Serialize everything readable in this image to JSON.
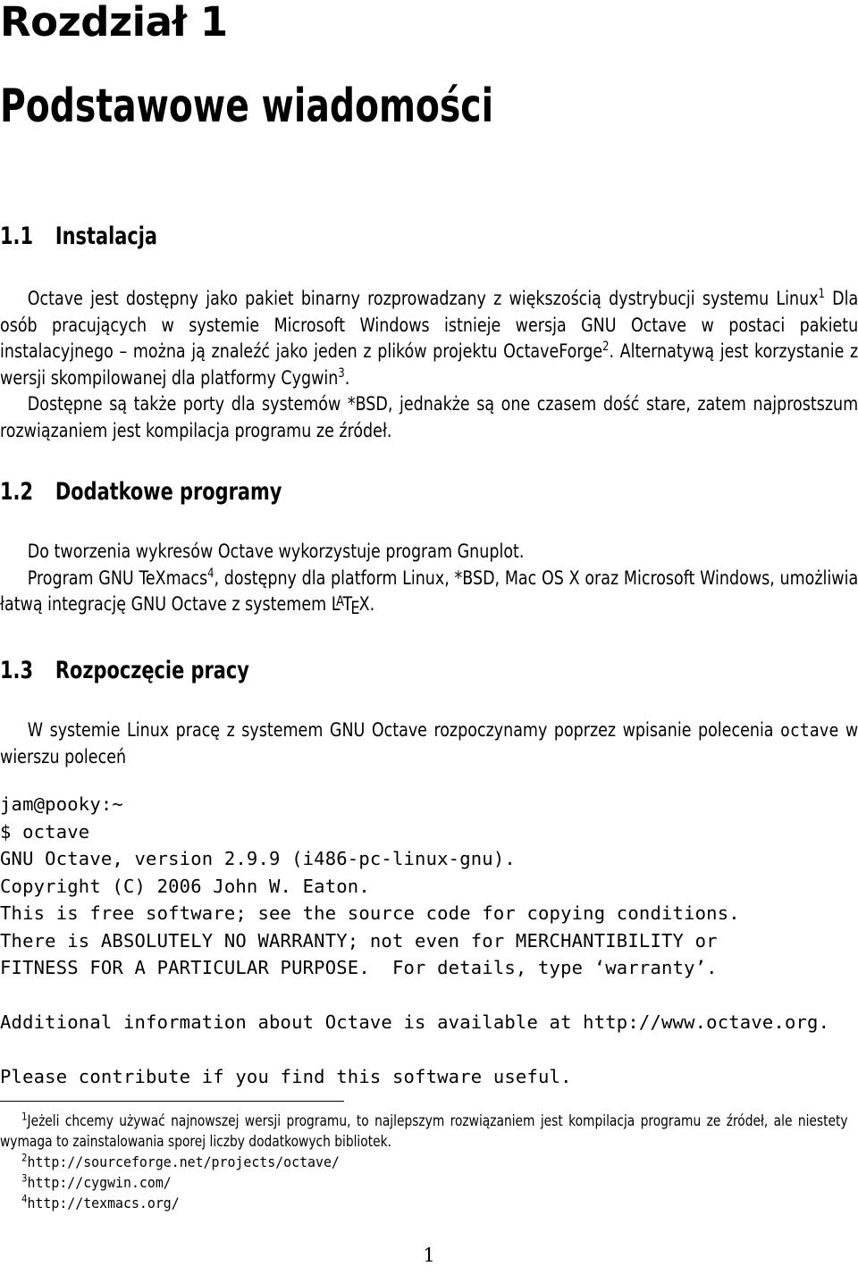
{
  "document": {
    "chapter_label": "Rozdział 1",
    "chapter_title": "Podstawowe wiadomości",
    "page_number": "1"
  },
  "sections": [
    {
      "number": "1.1",
      "title": "Instalacja",
      "paragraphs": [
        {
          "indent": true,
          "runs": [
            {
              "type": "text",
              "text": "Octave jest dostępny jako pakiet binarny rozprowadzany z większością dystrybucji systemu Linux"
            },
            {
              "type": "footnote_mark",
              "text": "1"
            },
            {
              "type": "text",
              "text": " Dla osób pracujących w systemie Microsoft Windows istnieje wersja GNU Octave w postaci pakietu instalacyjnego – można ją znaleźć jako jeden z plików projektu OctaveForge"
            },
            {
              "type": "footnote_mark",
              "text": "2"
            },
            {
              "type": "text",
              "text": ". Alternatywą jest korzystanie z wersji skompilowanej dla platformy Cygwin"
            },
            {
              "type": "footnote_mark",
              "text": "3"
            },
            {
              "type": "text",
              "text": "."
            }
          ]
        },
        {
          "indent": true,
          "runs": [
            {
              "type": "text",
              "text": "Dostępne są także porty dla systemów *BSD, jednakże są one czasem dość stare, zatem najprostszum rozwiązaniem jest kompilacja programu ze źródeł."
            }
          ]
        }
      ]
    },
    {
      "number": "1.2",
      "title": "Dodatkowe programy",
      "paragraphs": [
        {
          "indent": true,
          "runs": [
            {
              "type": "text",
              "text": "Do tworzenia wykresów Octave wykorzystuje program Gnuplot."
            }
          ]
        },
        {
          "indent": true,
          "runs": [
            {
              "type": "text",
              "text": "Program GNU TeXmacs"
            },
            {
              "type": "footnote_mark",
              "text": "4"
            },
            {
              "type": "text",
              "text": ", dostępny dla platform Linux, *BSD, Mac OS X oraz Microsoft Windows, umożliwia łatwą integrację GNU Octave z systemem "
            },
            {
              "type": "latex_logo",
              "text": "LaTeX"
            },
            {
              "type": "text",
              "text": "."
            }
          ]
        }
      ]
    },
    {
      "number": "1.3",
      "title": "Rozpoczęcie pracy",
      "paragraphs": [
        {
          "indent": true,
          "runs": [
            {
              "type": "text",
              "text": "W systemie Linux pracę z systemem GNU Octave rozpoczynamy poprzez wpisanie polecenia "
            },
            {
              "type": "mono",
              "text": "octave"
            },
            {
              "type": "text",
              "text": " w wierszu poleceń"
            }
          ]
        }
      ]
    }
  ],
  "terminal": {
    "lines": [
      "jam@pooky:~",
      "$ octave",
      "GNU Octave, version 2.9.9 (i486-pc-linux-gnu).",
      "Copyright (C) 2006 John W. Eaton.",
      "This is free software; see the source code for copying conditions.",
      "There is ABSOLUTELY NO WARRANTY; not even for MERCHANTIBILITY or",
      "FITNESS FOR A PARTICULAR PURPOSE.  For details, type ‘warranty’.",
      "",
      "Additional information about Octave is available at http://www.octave.org.",
      "",
      "Please contribute if you find this software useful."
    ]
  },
  "footnotes": [
    {
      "mark": "1",
      "text": "Jeżeli chcemy używać najnowszej wersji programu, to najlepszym rozwiązaniem jest kompilacja programu ze źródeł, ale niestety wymaga to zainstalowania sporej liczby dodatkowych bibliotek.",
      "mono": false
    },
    {
      "mark": "2",
      "text": "http://sourceforge.net/projects/octave/",
      "mono": true
    },
    {
      "mark": "3",
      "text": "http://cygwin.com/",
      "mono": true
    },
    {
      "mark": "4",
      "text": "http://texmacs.org/",
      "mono": true
    }
  ]
}
